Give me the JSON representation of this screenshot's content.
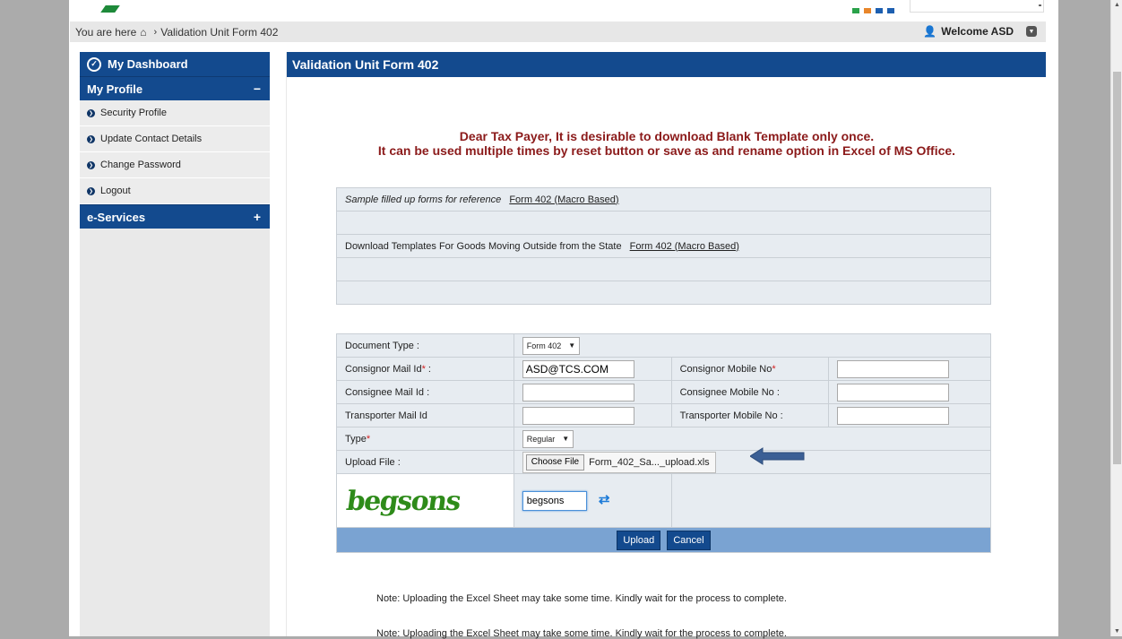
{
  "breadcrumb": {
    "prefix": "You are here",
    "current": "Validation Unit Form 402"
  },
  "header": {
    "welcome": "Welcome ASD",
    "color_squares": [
      "#2aa24a",
      "#e8862a",
      "#1d5fb0",
      "#1d5fb0"
    ]
  },
  "sidebar": {
    "dashboard": "My Dashboard",
    "profile_header": "My Profile",
    "profile_toggle": "−",
    "items": [
      {
        "label": "Security Profile"
      },
      {
        "label": "Update Contact Details"
      },
      {
        "label": "Change Password"
      },
      {
        "label": "Logout"
      }
    ],
    "eservices_header": "e-Services",
    "eservices_toggle": "+"
  },
  "main": {
    "title": "Validation Unit Form 402",
    "notice_line1": "Dear Tax Payer, It is desirable to download Blank Template only once.",
    "notice_line2": "It can be used multiple times by reset button or save as and rename option in Excel of MS Office.",
    "downloads": {
      "sample_label": "Sample filled up forms for reference",
      "sample_link": "Form 402 (Macro Based)",
      "templates_label": "Download Templates For Goods Moving Outside from the State",
      "templates_link": "Form 402 (Macro Based)"
    },
    "form": {
      "document_type_label": "Document Type :",
      "document_type_value": "Form 402",
      "consignor_mail_label": "Consignor Mail Id",
      "consignor_mail_value": "ASD@TCS.COM",
      "consignor_mobile_label": "Consignor Mobile No",
      "consignee_mail_label": "Consignee Mail Id :",
      "consignee_mobile_label": "Consignee Mobile No :",
      "transporter_mail_label": "Transporter Mail Id",
      "transporter_mobile_label": "Transporter Mobile No :",
      "type_label": "Type",
      "type_value": "Regular",
      "upload_label": "Upload File :",
      "choose_file": "Choose File",
      "file_name": "Form_402_Sa..._upload.xls",
      "captcha_text": "begsons",
      "captcha_input": "begsons",
      "upload_button": "Upload",
      "cancel_button": "Cancel"
    },
    "notes": [
      "Note: Uploading the Excel Sheet may take some time. Kindly wait for the process to complete.",
      "Note: Uploading the Excel Sheet may take some time. Kindly wait for the process to complete."
    ]
  }
}
